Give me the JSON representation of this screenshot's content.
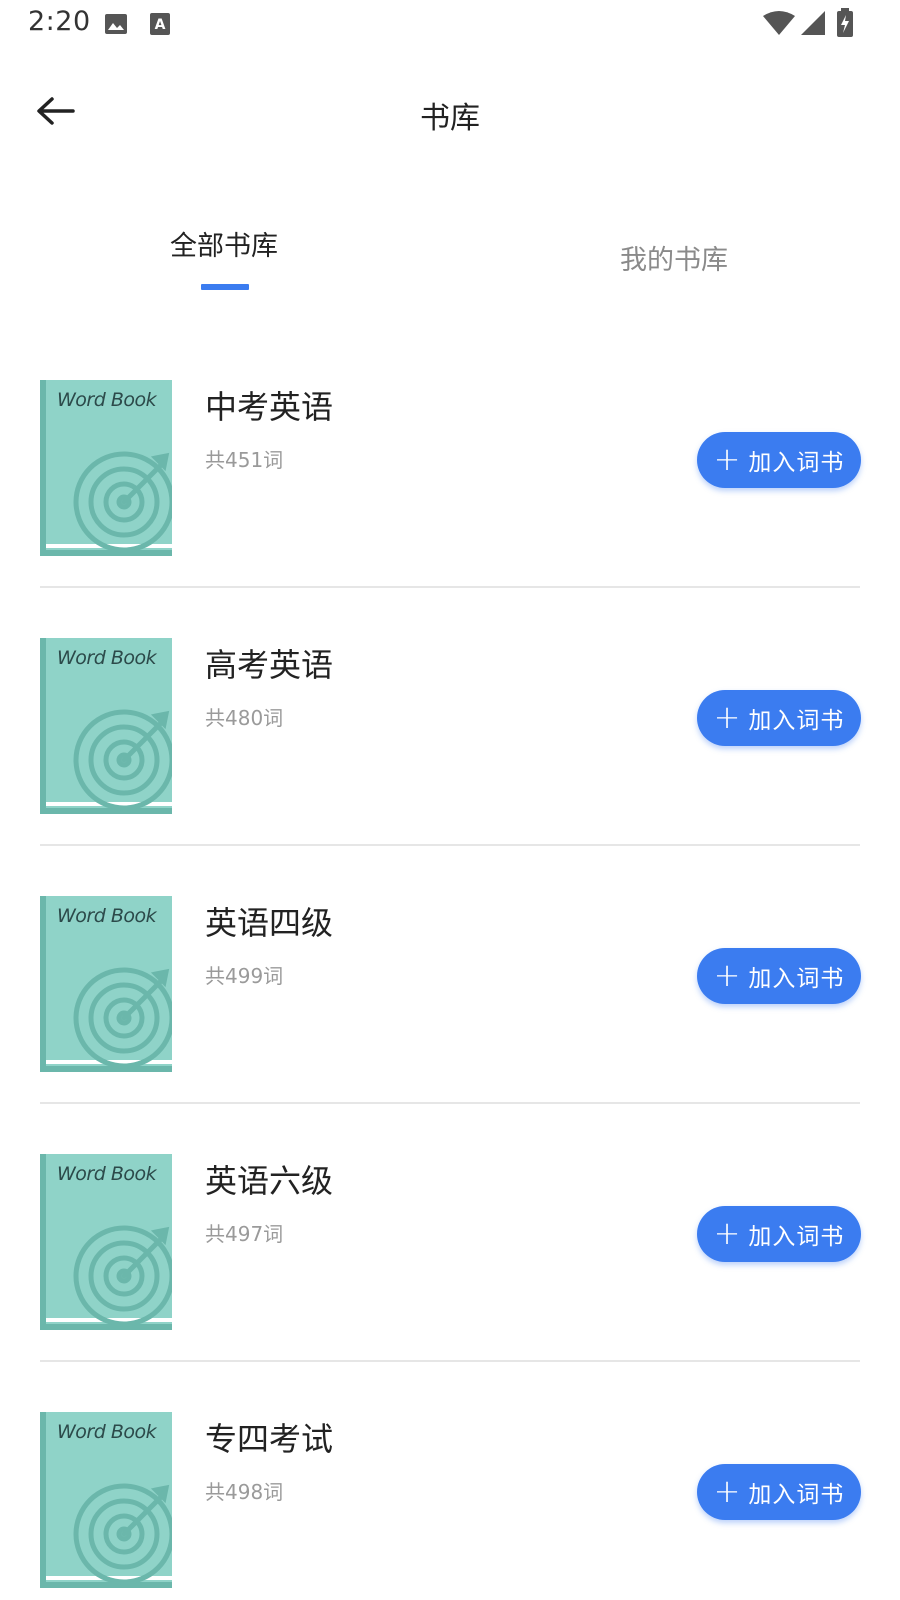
{
  "status_bar": {
    "time": "2:20",
    "icons": [
      "image-icon",
      "text-a-icon",
      "wifi-icon",
      "cell-signal-icon",
      "battery-charging-icon"
    ]
  },
  "header": {
    "title": "书库",
    "back_icon": "arrow-left-icon"
  },
  "tabs": [
    {
      "label": "全部书库",
      "active": true
    },
    {
      "label": "我的书库",
      "active": false
    }
  ],
  "colors": {
    "accent": "#3b7cf0",
    "cover": "#8fd3c8",
    "cover_spine": "#6bb7ab",
    "text_primary": "#222222",
    "text_secondary": "#9a9a9a"
  },
  "cover_label": "Word Book",
  "add_button_label": "加入词书",
  "add_button_icon": "plus-icon",
  "books": [
    {
      "name": "中考英语",
      "count": "共451词"
    },
    {
      "name": "高考英语",
      "count": "共480词"
    },
    {
      "name": "英语四级",
      "count": "共499词"
    },
    {
      "name": "英语六级",
      "count": "共497词"
    },
    {
      "name": "专四考试",
      "count": "共498词"
    }
  ]
}
